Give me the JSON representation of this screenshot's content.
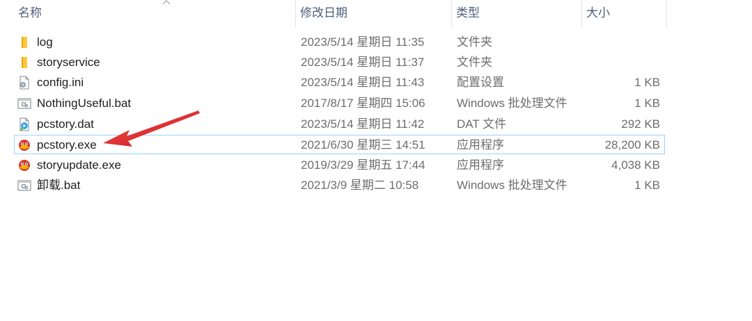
{
  "columns": {
    "name": "名称",
    "date": "修改日期",
    "type": "类型",
    "size": "大小"
  },
  "files": [
    {
      "name": "log",
      "date": "2023/5/14 星期日 11:35",
      "type": "文件夹",
      "size": "",
      "icon": "folder-icon"
    },
    {
      "name": "storyservice",
      "date": "2023/5/14 星期日 11:37",
      "type": "文件夹",
      "size": "",
      "icon": "folder-icon"
    },
    {
      "name": "config.ini",
      "date": "2023/5/14 星期日 11:43",
      "type": "配置设置",
      "size": "1 KB",
      "icon": "settings-file-icon"
    },
    {
      "name": "NothingUseful.bat",
      "date": "2017/8/17 星期四 15:06",
      "type": "Windows 批处理文件",
      "size": "1 KB",
      "icon": "batch-file-icon"
    },
    {
      "name": "pcstory.dat",
      "date": "2023/5/14 星期日 11:42",
      "type": "DAT 文件",
      "size": "292 KB",
      "icon": "media-file-icon"
    },
    {
      "name": "pcstory.exe",
      "date": "2021/6/30 星期三 14:51",
      "type": "应用程序",
      "size": "28,200 KB",
      "icon": "app-icon"
    },
    {
      "name": "storyupdate.exe",
      "date": "2019/3/29 星期五 17:44",
      "type": "应用程序",
      "size": "4,038 KB",
      "icon": "app-icon"
    },
    {
      "name": "卸载.bat",
      "date": "2021/3/9 星期二 10:58",
      "type": "Windows 批处理文件",
      "size": "1 KB",
      "icon": "batch-file-icon"
    }
  ],
  "selected_file": "pcstory.exe",
  "colors": {
    "header_text": "#4c607a",
    "selection_border": "#99d1ff",
    "annotation_arrow": "#e5262c"
  }
}
